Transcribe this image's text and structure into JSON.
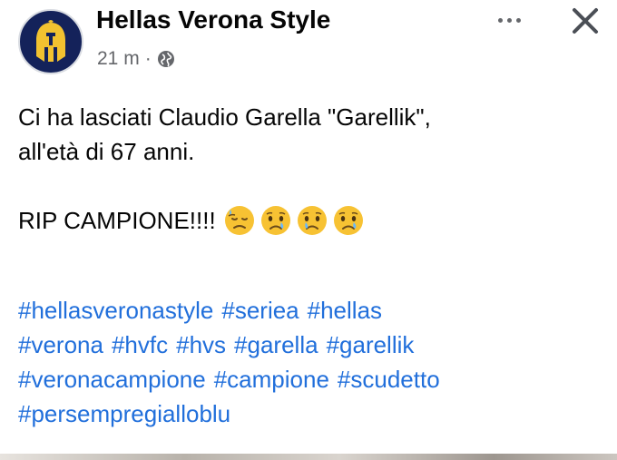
{
  "post": {
    "page_name": "Hellas Verona Style",
    "time_ago": "21 m",
    "separator": "·",
    "privacy_icon": "globe-icon",
    "body_lines": [
      "Ci ha lasciati Claudio Garella \"Garellik\",",
      "all'età di 67 anni."
    ],
    "rip_text": "RIP CAMPIONE!!!!",
    "emojis": [
      "downcast-face-with-sweat-emoji",
      "crying-face-emoji",
      "crying-face-emoji",
      "crying-face-emoji"
    ],
    "hashtag_rows": [
      [
        "#hellasveronastyle",
        "#seriea",
        "#hellas"
      ],
      [
        "#verona",
        "#hvfc",
        "#hvs",
        "#garella",
        "#garellik"
      ],
      [
        "#veronacampione",
        "#campione",
        "#scudetto"
      ],
      [
        "#persempregialloblu"
      ]
    ]
  },
  "colors": {
    "avatar_bg": "#14225a",
    "avatar_emblem": "#f2c230",
    "hashtag": "#216fdb",
    "meta_text": "#65676b"
  },
  "header": {
    "more_icon": "more-options-icon",
    "close_icon": "close-icon"
  }
}
